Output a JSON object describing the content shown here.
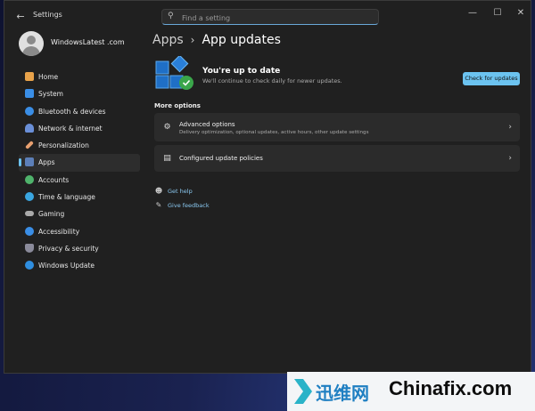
{
  "window": {
    "title": "Settings"
  },
  "search": {
    "placeholder": "Find a setting"
  },
  "profile": {
    "name": "WindowsLatest .com"
  },
  "sidebar": {
    "items": [
      {
        "label": "Home",
        "icon": "home-icon",
        "color": "#e8a24a"
      },
      {
        "label": "System",
        "icon": "monitor-icon",
        "color": "#3a8ee6"
      },
      {
        "label": "Bluetooth & devices",
        "icon": "bluetooth-icon",
        "color": "#3a8ee6"
      },
      {
        "label": "Network & internet",
        "icon": "wifi-icon",
        "color": "#6a8fd8"
      },
      {
        "label": "Personalization",
        "icon": "brush-icon",
        "color": "#e8a070"
      },
      {
        "label": "Apps",
        "icon": "apps-icon",
        "color": "#5c7fb8",
        "active": true
      },
      {
        "label": "Accounts",
        "icon": "person-icon",
        "color": "#4fb36b"
      },
      {
        "label": "Time & language",
        "icon": "globe-clock-icon",
        "color": "#3aa6e0"
      },
      {
        "label": "Gaming",
        "icon": "controller-icon",
        "color": "#aaaaaa"
      },
      {
        "label": "Accessibility",
        "icon": "accessibility-icon",
        "color": "#3a8ee6"
      },
      {
        "label": "Privacy & security",
        "icon": "shield-icon",
        "color": "#8a8a9a"
      },
      {
        "label": "Windows Update",
        "icon": "update-icon",
        "color": "#2f8ee0"
      }
    ]
  },
  "breadcrumb": {
    "parent": "Apps",
    "current": "App updates"
  },
  "status": {
    "title": "You're up to date",
    "subtitle": "We'll continue to check daily for newer updates.",
    "check_button": "Check for updates"
  },
  "more_options": {
    "title": "More options",
    "cards": [
      {
        "title": "Advanced options",
        "subtitle": "Delivery optimization, optional updates, active hours, other update settings",
        "icon": "gears-icon"
      },
      {
        "title": "Configured update policies",
        "subtitle": "",
        "icon": "policy-icon"
      }
    ]
  },
  "links": [
    {
      "label": "Get help",
      "icon": "help-icon"
    },
    {
      "label": "Give feedback",
      "icon": "feedback-icon"
    }
  ],
  "watermark": {
    "cn": "迅维网",
    "en": "Chinafix.com"
  },
  "colors": {
    "accent": "#6cc3f0",
    "window_bg": "#202020",
    "card_bg": "#2b2b2b"
  }
}
